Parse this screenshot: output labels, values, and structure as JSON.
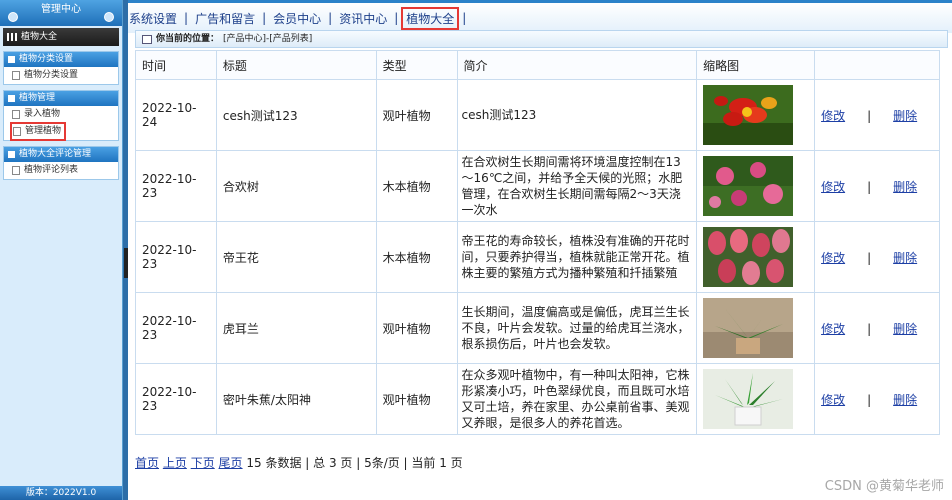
{
  "sidebar": {
    "header": "管理中心",
    "title": "植物大全",
    "groups": [
      {
        "label": "植物分类设置",
        "items": [
          {
            "label": "植物分类设置"
          }
        ]
      },
      {
        "label": "植物管理",
        "items": [
          {
            "label": "录入植物"
          },
          {
            "label": "管理植物"
          }
        ]
      },
      {
        "label": "植物大全评论管理",
        "items": [
          {
            "label": "植物评论列表"
          }
        ]
      }
    ],
    "footer": "版本：2022V1.0"
  },
  "nav": {
    "items": [
      "系统设置",
      "广告和留言",
      "会员中心",
      "资讯中心",
      "植物大全"
    ],
    "separator": "|",
    "active_index": 4
  },
  "breadcrumb": {
    "prefix": "你当前的位置：",
    "path": "[产品中心]-[产品列表]"
  },
  "table": {
    "headers": [
      "时间",
      "标题",
      "类型",
      "简介",
      "缩略图",
      ""
    ],
    "rows": [
      {
        "time": "2022-10-24",
        "title": "cesh测试123",
        "type": "观叶植物",
        "intro": "cesh测试123",
        "thumb": "red-orchid-flower"
      },
      {
        "time": "2022-10-23",
        "title": "合欢树",
        "type": "木本植物",
        "intro": "在合欢树生长期间需将环境温度控制在13～16℃之间，并给予全天候的光照；水肥管理，在合欢树生长期间需每隔2～3天浇一次水",
        "thumb": "pink-mimosa-flowers"
      },
      {
        "time": "2022-10-23",
        "title": "帝王花",
        "type": "木本植物",
        "intro": "帝王花的寿命较长，植株没有准确的开花时间，只要养护得当，植株就能正常开花。植株主要的繁殖方式为播种繁殖和扦插繁殖",
        "thumb": "pink-protea-flowers"
      },
      {
        "time": "2022-10-23",
        "title": "虎耳兰",
        "type": "观叶植物",
        "intro": "生长期间，温度偏高或是偏低，虎耳兰生长不良，叶片会发软。过量的给虎耳兰浇水，根系损伤后，叶片也会发软。",
        "thumb": "potted-green-plant"
      },
      {
        "time": "2022-10-23",
        "title": "密叶朱蕉/太阳神",
        "type": "观叶植物",
        "intro": "在众多观叶植物中，有一种叫太阳神，它株形紧凑小巧，叶色翠绿优良，而且既可水培又可土培，养在家里、办公桌前省事、美观又养眼，是很多人的养花首选。",
        "thumb": "potted-dracaena"
      }
    ],
    "edit_label": "修改",
    "delete_label": "删除",
    "action_sep": "|"
  },
  "pager": {
    "first": "首页",
    "prev": "上页",
    "next": "下页",
    "last": "尾页",
    "summary": "15 条数据 | 总 3 页 | 5条/页 | 当前 1 页"
  },
  "watermark": "CSDN @黄菊华老师"
}
